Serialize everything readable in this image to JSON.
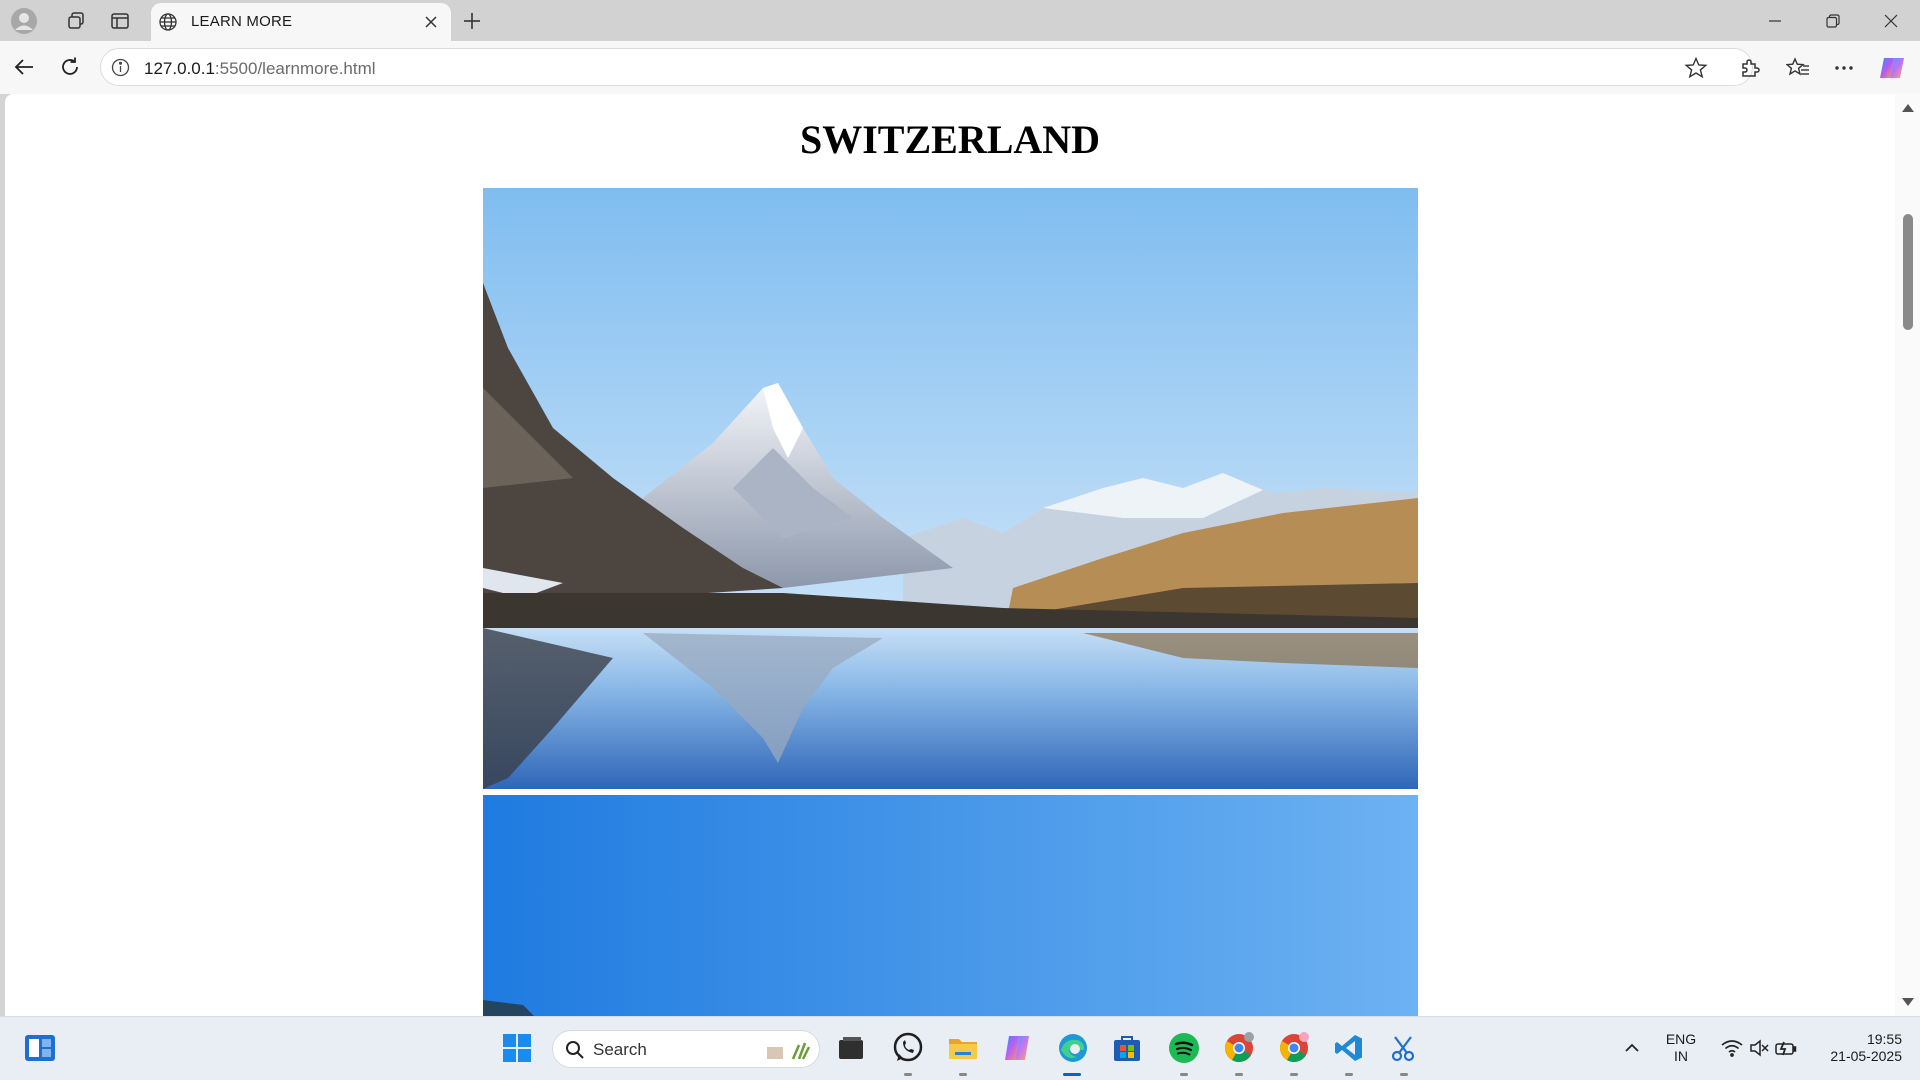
{
  "browser": {
    "tab_title": "LEARN MORE",
    "url_host": "127.0.0.1",
    "url_rest": ":5500/learnmore.html",
    "icons": [
      "profile-icon",
      "workspaces-icon",
      "tab-actions-icon",
      "globe-icon",
      "close-icon",
      "new-tab-icon",
      "minimize-icon",
      "restore-icon",
      "window-close-icon",
      "back-icon",
      "refresh-icon",
      "site-info-icon",
      "favorite-icon",
      "extensions-icon",
      "favorites-icon",
      "more-icon",
      "copilot-icon"
    ]
  },
  "page": {
    "title": "SWITZERLAND",
    "images": [
      "matterhorn-lake-reflection",
      "blue-sky-mountain"
    ]
  },
  "taskbar": {
    "search_label": "Search",
    "language_line1": "ENG",
    "language_line2": "IN",
    "time": "19:55",
    "date": "21-05-2025",
    "apps": [
      "start",
      "file-explorer",
      "whatsapp",
      "folder",
      "copilot",
      "edge",
      "store",
      "spotify",
      "chrome",
      "chrome-profile",
      "vscode",
      "snipping-tool"
    ]
  },
  "colors": {
    "sky_top": "#8cc4f2",
    "water": "#3f78c8",
    "accent": "#0067c0"
  }
}
